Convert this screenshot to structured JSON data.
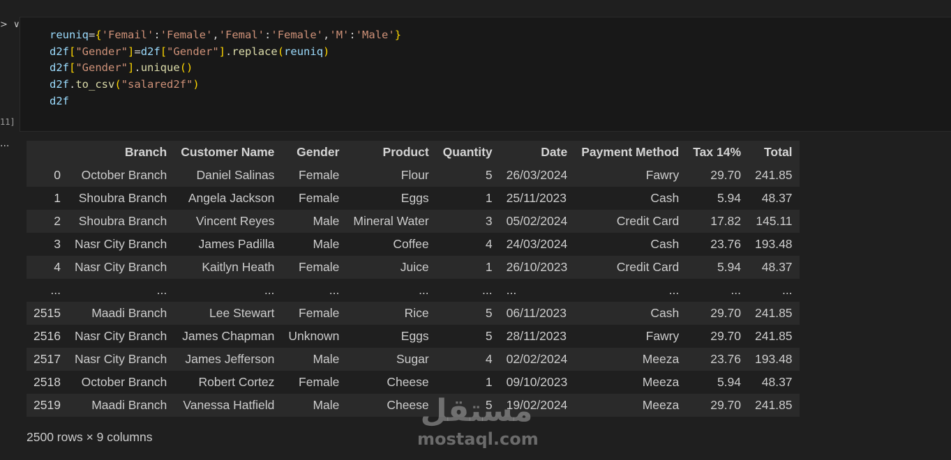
{
  "gutter": {
    "chevron": "> ∨",
    "execution_count": "11]",
    "output_menu": "..."
  },
  "code_lines": [
    [
      {
        "t": "reuniq",
        "c": "var"
      },
      {
        "t": "=",
        "c": "op"
      },
      {
        "t": "{",
        "c": "b1"
      },
      {
        "t": "'Femail'",
        "c": "str"
      },
      {
        "t": ":",
        "c": "op"
      },
      {
        "t": "'Female'",
        "c": "str"
      },
      {
        "t": ",",
        "c": "op"
      },
      {
        "t": "'Femal'",
        "c": "str"
      },
      {
        "t": ":",
        "c": "op"
      },
      {
        "t": "'Female'",
        "c": "str"
      },
      {
        "t": ",",
        "c": "op"
      },
      {
        "t": "'M'",
        "c": "str"
      },
      {
        "t": ":",
        "c": "op"
      },
      {
        "t": "'Male'",
        "c": "str"
      },
      {
        "t": "}",
        "c": "b1"
      }
    ],
    [
      {
        "t": "d2f",
        "c": "var"
      },
      {
        "t": "[",
        "c": "b1"
      },
      {
        "t": "\"Gender\"",
        "c": "str"
      },
      {
        "t": "]",
        "c": "b1"
      },
      {
        "t": "=",
        "c": "op"
      },
      {
        "t": "d2f",
        "c": "var"
      },
      {
        "t": "[",
        "c": "b1"
      },
      {
        "t": "\"Gender\"",
        "c": "str"
      },
      {
        "t": "]",
        "c": "b1"
      },
      {
        "t": ".",
        "c": "op"
      },
      {
        "t": "replace",
        "c": "fn"
      },
      {
        "t": "(",
        "c": "b1"
      },
      {
        "t": "reuniq",
        "c": "var"
      },
      {
        "t": ")",
        "c": "b1"
      }
    ],
    [
      {
        "t": "d2f",
        "c": "var"
      },
      {
        "t": "[",
        "c": "b1"
      },
      {
        "t": "\"Gender\"",
        "c": "str"
      },
      {
        "t": "]",
        "c": "b1"
      },
      {
        "t": ".",
        "c": "op"
      },
      {
        "t": "unique",
        "c": "fn"
      },
      {
        "t": "()",
        "c": "b1"
      }
    ],
    [
      {
        "t": "d2f",
        "c": "var"
      },
      {
        "t": ".",
        "c": "op"
      },
      {
        "t": "to_csv",
        "c": "fn"
      },
      {
        "t": "(",
        "c": "b1"
      },
      {
        "t": "\"salared2f\"",
        "c": "str"
      },
      {
        "t": ")",
        "c": "b1"
      }
    ],
    [
      {
        "t": "d2f",
        "c": "var"
      }
    ]
  ],
  "table": {
    "columns": [
      "",
      "Branch",
      "Customer Name",
      "Gender",
      "Product",
      "Quantity",
      "Date",
      "Payment Method",
      "Tax 14%",
      "Total"
    ],
    "rows": [
      [
        "0",
        "October Branch",
        "Daniel Salinas",
        "Female",
        "Flour",
        "5",
        "26/03/2024",
        "Fawry",
        "29.70",
        "241.85"
      ],
      [
        "1",
        "Shoubra Branch",
        "Angela Jackson",
        "Female",
        "Eggs",
        "1",
        "25/11/2023",
        "Cash",
        "5.94",
        "48.37"
      ],
      [
        "2",
        "Shoubra Branch",
        "Vincent Reyes",
        "Male",
        "Mineral Water",
        "3",
        "05/02/2024",
        "Credit Card",
        "17.82",
        "145.11"
      ],
      [
        "3",
        "Nasr City Branch",
        "James Padilla",
        "Male",
        "Coffee",
        "4",
        "24/03/2024",
        "Cash",
        "23.76",
        "193.48"
      ],
      [
        "4",
        "Nasr City Branch",
        "Kaitlyn Heath",
        "Female",
        "Juice",
        "1",
        "26/10/2023",
        "Credit Card",
        "5.94",
        "48.37"
      ],
      [
        "...",
        "...",
        "...",
        "...",
        "...",
        "...",
        "...",
        "...",
        "...",
        "..."
      ],
      [
        "2515",
        "Maadi Branch",
        "Lee Stewart",
        "Female",
        "Rice",
        "5",
        "06/11/2023",
        "Cash",
        "29.70",
        "241.85"
      ],
      [
        "2516",
        "Nasr City Branch",
        "James Chapman",
        "Unknown",
        "Eggs",
        "5",
        "28/11/2023",
        "Fawry",
        "29.70",
        "241.85"
      ],
      [
        "2517",
        "Nasr City Branch",
        "James Jefferson",
        "Male",
        "Sugar",
        "4",
        "02/02/2024",
        "Meeza",
        "23.76",
        "193.48"
      ],
      [
        "2518",
        "October Branch",
        "Robert Cortez",
        "Female",
        "Cheese",
        "1",
        "09/10/2023",
        "Meeza",
        "5.94",
        "48.37"
      ],
      [
        "2519",
        "Maadi Branch",
        "Vanessa Hatfield",
        "Male",
        "Cheese",
        "5",
        "19/02/2024",
        "Meeza",
        "29.70",
        "241.85"
      ]
    ]
  },
  "shape_text": "2500 rows × 9 columns",
  "watermark": {
    "arabic": "مستقل",
    "latin": "mostaql.com"
  }
}
